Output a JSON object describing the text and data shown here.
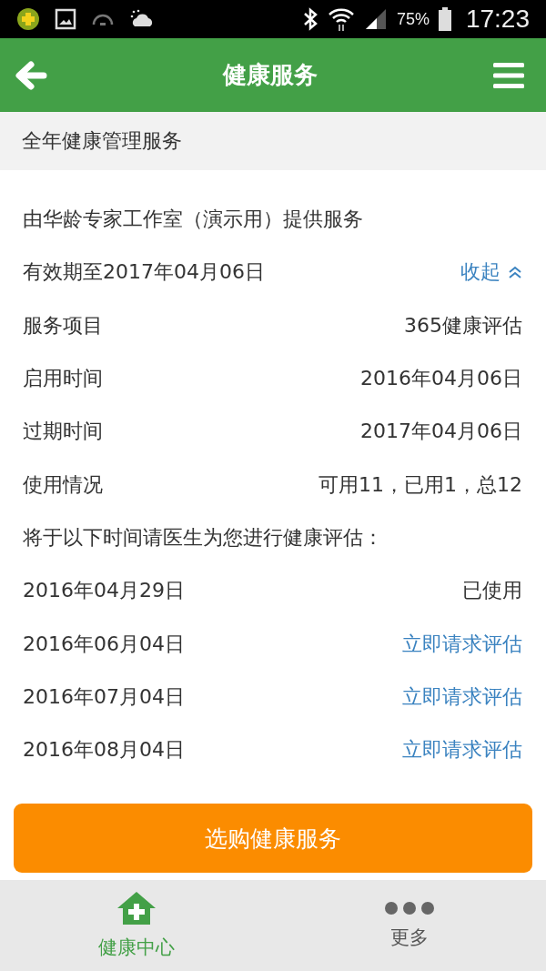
{
  "status_bar": {
    "battery": "75%",
    "time": "17:23"
  },
  "header": {
    "title": "健康服务"
  },
  "section": {
    "title": "全年健康管理服务"
  },
  "provider": "由华龄专家工作室（演示用）提供服务",
  "validity": {
    "text": "有效期至2017年04月06日",
    "toggle": "收起",
    "expanded": true
  },
  "details": [
    {
      "label": "服务项目",
      "value": "365健康评估"
    },
    {
      "label": "启用时间",
      "value": "2016年04月06日"
    },
    {
      "label": "过期时间",
      "value": "2017年04月06日"
    },
    {
      "label": "使用情况",
      "value": "可用11，已用1，总12"
    }
  ],
  "schedule_heading": "将于以下时间请医生为您进行健康评估：",
  "schedule": [
    {
      "date": "2016年04月29日",
      "status": "已使用",
      "kind": "used"
    },
    {
      "date": "2016年06月04日",
      "status": "立即请求评估",
      "kind": "request"
    },
    {
      "date": "2016年07月04日",
      "status": "立即请求评估",
      "kind": "request"
    },
    {
      "date": "2016年08月04日",
      "status": "立即请求评估",
      "kind": "request"
    }
  ],
  "purchase_button": "选购健康服务",
  "tabs": [
    {
      "label": "健康中心",
      "selected": true,
      "kind": "home"
    },
    {
      "label": "更多",
      "selected": false,
      "kind": "more"
    }
  ]
}
